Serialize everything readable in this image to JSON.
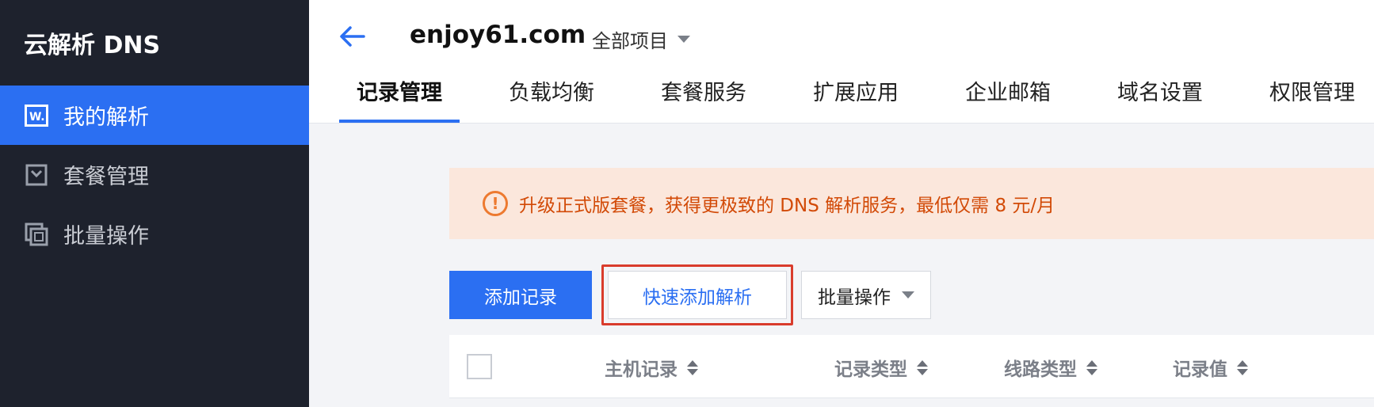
{
  "sidebar": {
    "brand": "云解析 DNS",
    "items": [
      {
        "label": "我的解析",
        "icon": "w-logo-icon",
        "active": true
      },
      {
        "label": "套餐管理",
        "icon": "package-icon",
        "active": false
      },
      {
        "label": "批量操作",
        "icon": "batch-icon",
        "active": false
      }
    ]
  },
  "header": {
    "domain": "enjoy61.com",
    "project": "全部项目",
    "tabs": [
      {
        "label": "记录管理",
        "active": true
      },
      {
        "label": "负载均衡",
        "active": false
      },
      {
        "label": "套餐服务",
        "active": false
      },
      {
        "label": "扩展应用",
        "active": false
      },
      {
        "label": "企业邮箱",
        "active": false
      },
      {
        "label": "域名设置",
        "active": false
      },
      {
        "label": "权限管理",
        "active": false
      }
    ]
  },
  "notice": {
    "text": "升级正式版套餐，获得更极致的 DNS 解析服务，最低仅需 8 元/月",
    "icon": "warning-circle-icon"
  },
  "toolbar": {
    "add_label": "添加记录",
    "quick_add_label": "快速添加解析",
    "batch_label": "批量操作"
  },
  "table": {
    "columns": [
      "主机记录",
      "记录类型",
      "线路类型",
      "记录值"
    ]
  },
  "colors": {
    "accent": "#2b6ff2",
    "sidebar_bg": "#1e222d",
    "notice_bg": "#fbe7dc",
    "notice_text": "#d24a07",
    "highlight_box": "#d93c2c"
  }
}
